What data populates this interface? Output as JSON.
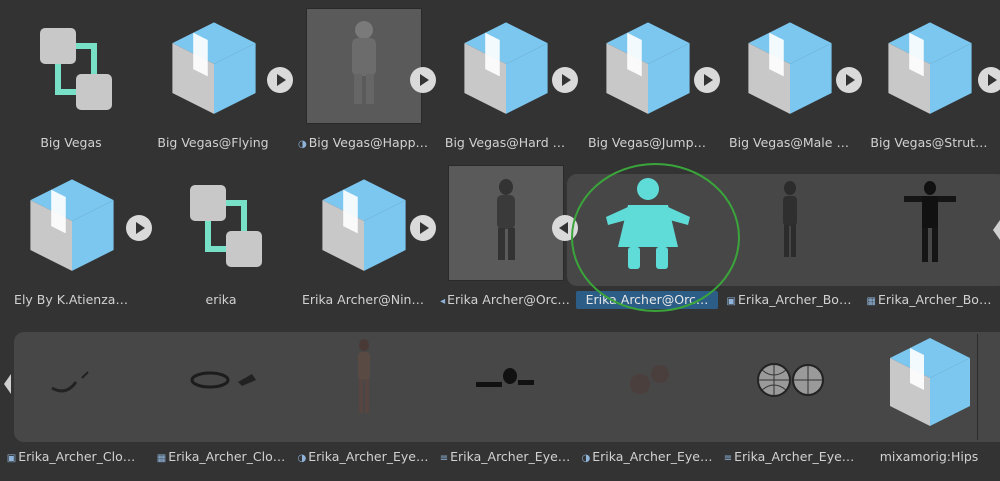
{
  "rows": [
    [
      {
        "label": "Big Vegas",
        "icon": "prefab-variant-icon"
      },
      {
        "label": "Big Vegas@Flying",
        "icon": "model-icon",
        "expand": true
      },
      {
        "label": "Big Vegas@Happ…",
        "icon": "preview",
        "prefix": "◑"
      },
      {
        "label": "Big Vegas@Hard …",
        "icon": "model-icon",
        "expand": true
      },
      {
        "label": "Big Vegas@Jump…",
        "icon": "model-icon",
        "expand": true
      },
      {
        "label": "Big Vegas@Male …",
        "icon": "model-icon",
        "expand": true
      },
      {
        "label": "Big Vegas@Strut…",
        "icon": "model-icon",
        "expand": true
      }
    ],
    [
      {
        "label": "Ely By K.Atienza…",
        "icon": "model-icon",
        "expand": true
      },
      {
        "label": "erika",
        "icon": "prefab-variant-icon"
      },
      {
        "label": "Erika Archer@Nin…",
        "icon": "model-icon",
        "expand": true
      },
      {
        "label": "Erika Archer@Orc…",
        "icon": "preview",
        "prefix": "◂"
      },
      {
        "label": "Erika Archer@Orc…",
        "icon": "avatar-icon",
        "selected": true
      },
      {
        "label": "Erika_Archer_Bo…",
        "icon": "mesh-preview",
        "prefix": "▣"
      },
      {
        "label": "Erika_Archer_Bo…",
        "icon": "wire-preview",
        "prefix": "▦"
      }
    ],
    [
      {
        "label": "Erika_Archer_Clo…",
        "icon": "mesh-preview",
        "prefix": "▣"
      },
      {
        "label": "Erika_Archer_Clo…",
        "icon": "mesh-preview",
        "prefix": "▦"
      },
      {
        "label": "Erika_Archer_Eye…",
        "icon": "mesh-preview",
        "prefix": "◑"
      },
      {
        "label": "Erika_Archer_Eye…",
        "icon": "mesh-preview",
        "prefix": "≡"
      },
      {
        "label": "Erika_Archer_Eye…",
        "icon": "mesh-preview",
        "prefix": "◑"
      },
      {
        "label": "Erika_Archer_Eye…",
        "icon": "mesh-preview",
        "prefix": "≡"
      },
      {
        "label": "mixamorig:Hips",
        "icon": "model-icon"
      }
    ]
  ],
  "colors": {
    "cube_blue": "#7cc7f0",
    "cube_grey": "#c8c8c8",
    "prefab_teal": "#77e0c6",
    "avatar_teal": "#5fdcd8",
    "selection": "#2c5d87",
    "annotation": "#3aa53a"
  }
}
